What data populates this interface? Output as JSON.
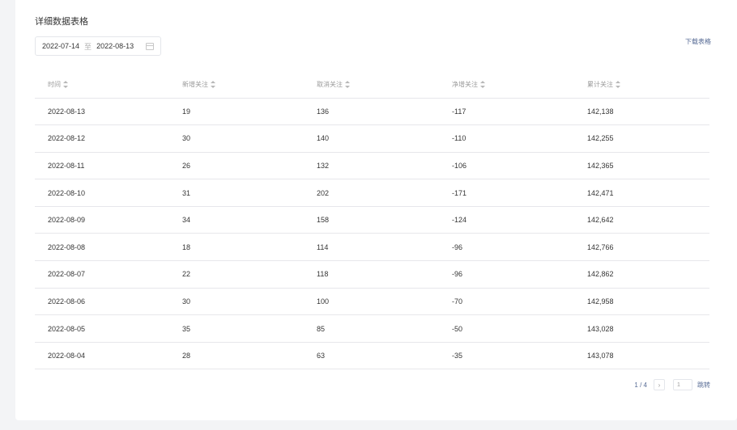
{
  "section": {
    "title": "详细数据表格"
  },
  "date_range": {
    "start": "2022-07-14",
    "separator": "至",
    "end": "2022-08-13",
    "icon": "calendar-icon"
  },
  "download_label": "下载表格",
  "table": {
    "columns": [
      "时间",
      "新增关注",
      "取消关注",
      "净增关注",
      "累计关注"
    ],
    "rows": [
      [
        "2022-08-13",
        "19",
        "136",
        "-117",
        "142,138"
      ],
      [
        "2022-08-12",
        "30",
        "140",
        "-110",
        "142,255"
      ],
      [
        "2022-08-11",
        "26",
        "132",
        "-106",
        "142,365"
      ],
      [
        "2022-08-10",
        "31",
        "202",
        "-171",
        "142,471"
      ],
      [
        "2022-08-09",
        "34",
        "158",
        "-124",
        "142,642"
      ],
      [
        "2022-08-08",
        "18",
        "114",
        "-96",
        "142,766"
      ],
      [
        "2022-08-07",
        "22",
        "118",
        "-96",
        "142,862"
      ],
      [
        "2022-08-06",
        "30",
        "100",
        "-70",
        "142,958"
      ],
      [
        "2022-08-05",
        "35",
        "85",
        "-50",
        "143,028"
      ],
      [
        "2022-08-04",
        "28",
        "63",
        "-35",
        "143,078"
      ]
    ]
  },
  "pagination": {
    "page_info": "1 / 4",
    "next_icon": "chevron-right-icon",
    "next_glyph": "›",
    "page_input": "1",
    "jump_label": "跳转"
  },
  "colors": {
    "accent": "#576b95",
    "background": "#f3f4f6",
    "border": "#e7e7eb"
  }
}
